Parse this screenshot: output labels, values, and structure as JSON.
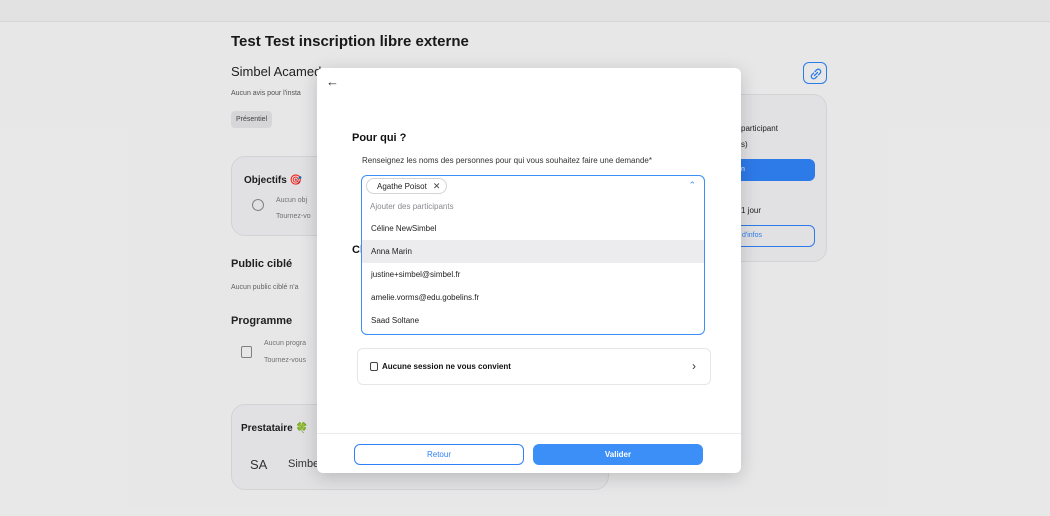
{
  "background": {
    "title": "Test Test inscription libre externe",
    "subtitle": "Simbel Acamed",
    "avis": "Aucun avis pour l'insta",
    "chip": "Présentiel",
    "objectifs": {
      "heading": "Objectifs 🎯",
      "line1": "Aucun obj",
      "line2": "Tournez-vo"
    },
    "public": {
      "heading": "Public ciblé",
      "text": "Aucun public ciblé n'a"
    },
    "programme": {
      "heading": "Programme",
      "line1": "Aucun progra",
      "line2": "Tournez-vous"
    },
    "prestataire": {
      "heading": "Prestataire 🍀",
      "initials": "SA",
      "name": "Simbe"
    },
    "right_card": {
      "line1": "participant",
      "line2": "s)",
      "btn1": "n",
      "line3": "1 jour",
      "btn2": "d'infos"
    }
  },
  "modal": {
    "back_icon": "←",
    "title": "Pour qui ?",
    "description": "Renseignez les noms des personnes pour qui vous souhaitez faire une demande*",
    "hidden_heading": "Cl",
    "select": {
      "selected_tags": [
        "Agathe Poisot"
      ],
      "tag_remove_icon": "✕",
      "chevron_icon": "⌃",
      "placeholder": "Ajouter des participants",
      "options": [
        "Céline NewSimbel",
        "Anna Marin",
        "justine+simbel@simbel.fr",
        "amelie.vorms@edu.gobelins.fr",
        "Saad Soltane"
      ],
      "highlighted_index": 1
    },
    "session": {
      "label": "Aucune session ne vous convient",
      "chevron": "›"
    },
    "footer": {
      "back_label": "Retour",
      "submit_label": "Valider"
    }
  },
  "colors": {
    "accent": "#3b8ff6",
    "overlay": "rgba(18,18,20,0.06)"
  }
}
